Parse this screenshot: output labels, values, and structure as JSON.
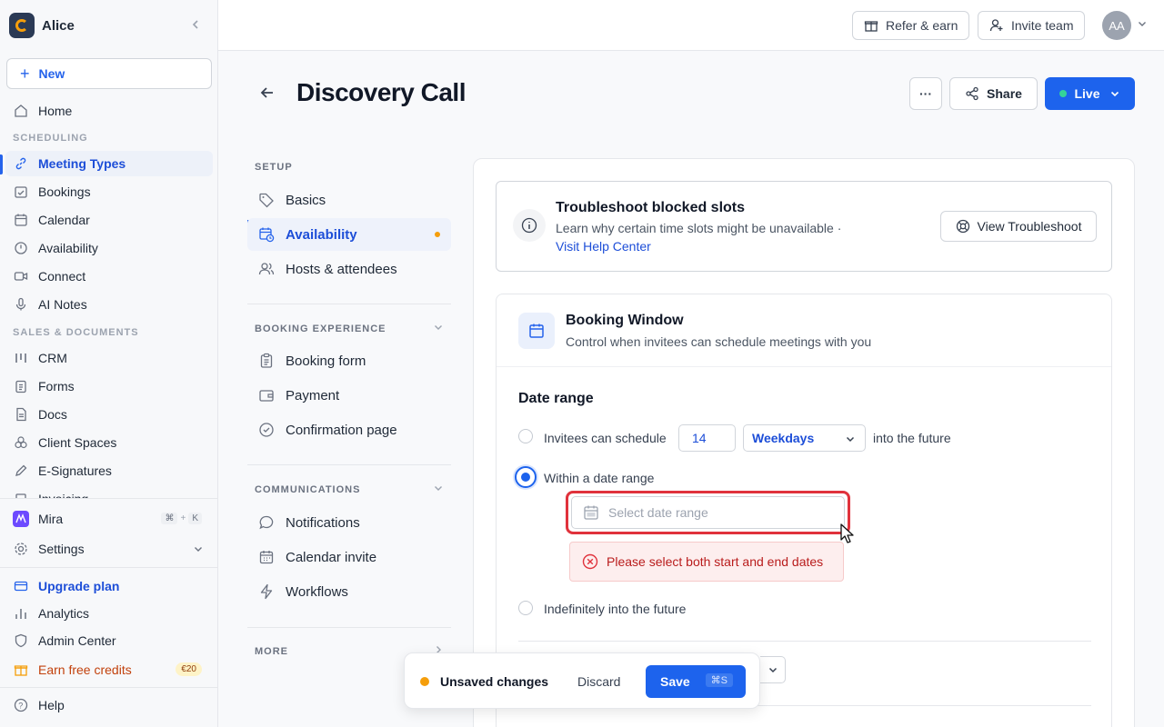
{
  "workspace": {
    "name": "Alice"
  },
  "sidebar": {
    "new_label": "New",
    "home": "Home",
    "section_scheduling": "SCHEDULING",
    "scheduling_items": [
      {
        "label": "Meeting Types",
        "icon": "link-icon"
      },
      {
        "label": "Bookings",
        "icon": "calendar-check-icon"
      },
      {
        "label": "Calendar",
        "icon": "calendar-icon"
      },
      {
        "label": "Availability",
        "icon": "clock-icon"
      },
      {
        "label": "Connect",
        "icon": "video-icon"
      },
      {
        "label": "AI Notes",
        "icon": "microphone-icon"
      }
    ],
    "section_sales": "SALES & DOCUMENTS",
    "sales_items": [
      {
        "label": "CRM",
        "icon": "crm-icon"
      },
      {
        "label": "Forms",
        "icon": "clipboard-icon"
      },
      {
        "label": "Docs",
        "icon": "document-icon"
      },
      {
        "label": "Client Spaces",
        "icon": "spaces-icon"
      },
      {
        "label": "E-Signatures",
        "icon": "pen-icon"
      },
      {
        "label": "Invoicing",
        "icon": "invoice-icon"
      }
    ],
    "mira": {
      "label": "Mira",
      "shortcut_1": "⌘",
      "shortcut_sep": "+",
      "shortcut_2": "K"
    },
    "settings": "Settings",
    "upgrade": "Upgrade plan",
    "analytics": "Analytics",
    "admin": "Admin Center",
    "earn": "Earn free credits",
    "earn_badge": "€20",
    "help": "Help"
  },
  "topbar": {
    "refer": "Refer & earn",
    "invite": "Invite team",
    "avatar_initials": "AA"
  },
  "header": {
    "title": "Discovery Call",
    "more": "···",
    "share": "Share",
    "live": "Live"
  },
  "settings_nav": {
    "setup_label": "SETUP",
    "setup_items": [
      {
        "label": "Basics",
        "icon": "tag-icon"
      },
      {
        "label": "Availability",
        "icon": "calendar-clock-icon"
      },
      {
        "label": "Hosts & attendees",
        "icon": "users-icon"
      }
    ],
    "booking_label": "BOOKING EXPERIENCE",
    "booking_items": [
      {
        "label": "Booking form",
        "icon": "clipboard-icon"
      },
      {
        "label": "Payment",
        "icon": "wallet-icon"
      },
      {
        "label": "Confirmation page",
        "icon": "check-circle-icon"
      }
    ],
    "comms_label": "COMMUNICATIONS",
    "comms_items": [
      {
        "label": "Notifications",
        "icon": "chat-icon"
      },
      {
        "label": "Calendar invite",
        "icon": "calendar-icon"
      },
      {
        "label": "Workflows",
        "icon": "bolt-icon"
      }
    ],
    "more_label": "MORE"
  },
  "troubleshoot": {
    "title": "Troubleshoot blocked slots",
    "desc": "Learn why certain time slots might be unavailable ·",
    "link": "Visit Help Center",
    "button": "View Troubleshoot"
  },
  "booking_window": {
    "title": "Booking Window",
    "desc": "Control when invitees can schedule meetings with you",
    "date_range_title": "Date range",
    "option_1_prefix": "Invitees can schedule",
    "days_value": "14",
    "days_unit": "Weekdays",
    "option_1_suffix": "into the future",
    "option_2": "Within a date range",
    "date_placeholder": "Select date range",
    "error": "Please select both start and end dates",
    "option_3": "Indefinitely into the future"
  },
  "unsaved": {
    "text": "Unsaved changes",
    "discard": "Discard",
    "save": "Save",
    "shortcut": "⌘S"
  },
  "colors": {
    "accent": "#1d63ed",
    "error": "#e0323c",
    "warning": "#f59e0b"
  }
}
